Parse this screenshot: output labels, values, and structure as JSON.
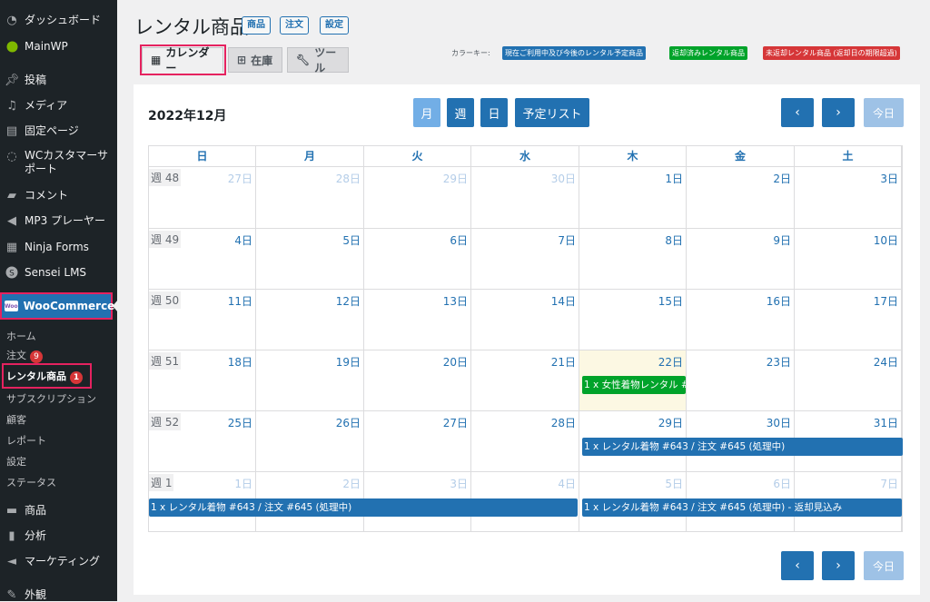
{
  "sidebar": {
    "items": [
      {
        "label": "ダッシュボード",
        "icon": "dashboard-icon"
      },
      {
        "label": "MainWP",
        "icon": "mainwp-icon"
      },
      {
        "label": "投稿",
        "icon": "pin-icon"
      },
      {
        "label": "メディア",
        "icon": "media-icon"
      },
      {
        "label": "固定ページ",
        "icon": "page-icon"
      },
      {
        "label": "WCカスタマーサ",
        "label2": "ポート",
        "icon": "support-icon"
      },
      {
        "label": "コメント",
        "icon": "comment-icon"
      },
      {
        "label": "MP3 プレーヤー",
        "icon": "audio-icon"
      },
      {
        "label": "Ninja Forms",
        "icon": "forms-icon"
      },
      {
        "label": "Sensei LMS",
        "icon": "sensei-icon"
      },
      {
        "label": "WooCommerce",
        "icon": "woocommerce-icon"
      },
      {
        "label": "商品",
        "icon": "archive-icon"
      },
      {
        "label": "分析",
        "icon": "chart-icon"
      },
      {
        "label": "マーケティング",
        "icon": "megaphone-icon"
      },
      {
        "label": "外観",
        "icon": "appearance-icon"
      }
    ],
    "woo_icon_text": "Woo",
    "submenu": [
      {
        "label": "ホーム"
      },
      {
        "label": "注文",
        "badge": "9"
      },
      {
        "label": "レンタル商品",
        "badge": "1"
      },
      {
        "label": "サブスクリプション"
      },
      {
        "label": "顧客"
      },
      {
        "label": "レポート"
      },
      {
        "label": "設定"
      },
      {
        "label": "ステータス"
      }
    ]
  },
  "header": {
    "title": "レンタル商品",
    "buttons": [
      "商品",
      "注文",
      "設定"
    ],
    "tabs": [
      {
        "label": "カレンダー",
        "icon": "calendar-icon"
      },
      {
        "label": "在庫",
        "icon": "grid-icon"
      },
      {
        "label": "ツール",
        "icon": "wrench-icon"
      }
    ],
    "color_key_label": "カラーキー:",
    "keys": [
      {
        "label": "現在ご利用中及び今後のレンタル予定商品",
        "color": "#2271b1"
      },
      {
        "label": "返却済みレンタル商品",
        "color": "#00a32a"
      },
      {
        "label": "未返却レンタル商品 (返却日の期限超過)",
        "color": "#d63638"
      }
    ]
  },
  "calendar": {
    "month": "2022年12月",
    "views": [
      "月",
      "週",
      "日",
      "予定リスト"
    ],
    "prev": "‹",
    "next": "›",
    "today": "今日",
    "weekdays": [
      "日",
      "月",
      "火",
      "水",
      "木",
      "金",
      "土"
    ],
    "weeks": [
      {
        "label": "週 48",
        "days": [
          "27日",
          "28日",
          "29日",
          "30日",
          "1日",
          "2日",
          "3日"
        ]
      },
      {
        "label": "週 49",
        "days": [
          "4日",
          "5日",
          "6日",
          "7日",
          "8日",
          "9日",
          "10日"
        ]
      },
      {
        "label": "週 50",
        "days": [
          "11日",
          "12日",
          "13日",
          "14日",
          "15日",
          "16日",
          "17日"
        ]
      },
      {
        "label": "週 51",
        "days": [
          "18日",
          "19日",
          "20日",
          "21日",
          "22日",
          "23日",
          "24日"
        ]
      },
      {
        "label": "週 52",
        "days": [
          "25日",
          "26日",
          "27日",
          "28日",
          "29日",
          "30日",
          "31日"
        ]
      },
      {
        "label": "週 1",
        "days": [
          "1日",
          "2日",
          "3日",
          "4日",
          "5日",
          "6日",
          "7日"
        ]
      }
    ],
    "events": [
      {
        "text": "1 x 女性着物レンタル #",
        "color": "green"
      },
      {
        "text": "1 x レンタル着物 #643 / 注文 #645 (処理中)",
        "color": "blue"
      },
      {
        "text": "1 x レンタル着物 #643 / 注文 #645 (処理中)",
        "color": "blue"
      },
      {
        "text": "1 x レンタル着物 #643 / 注文 #645 (処理中) - 返却見込み",
        "color": "blue"
      }
    ]
  }
}
